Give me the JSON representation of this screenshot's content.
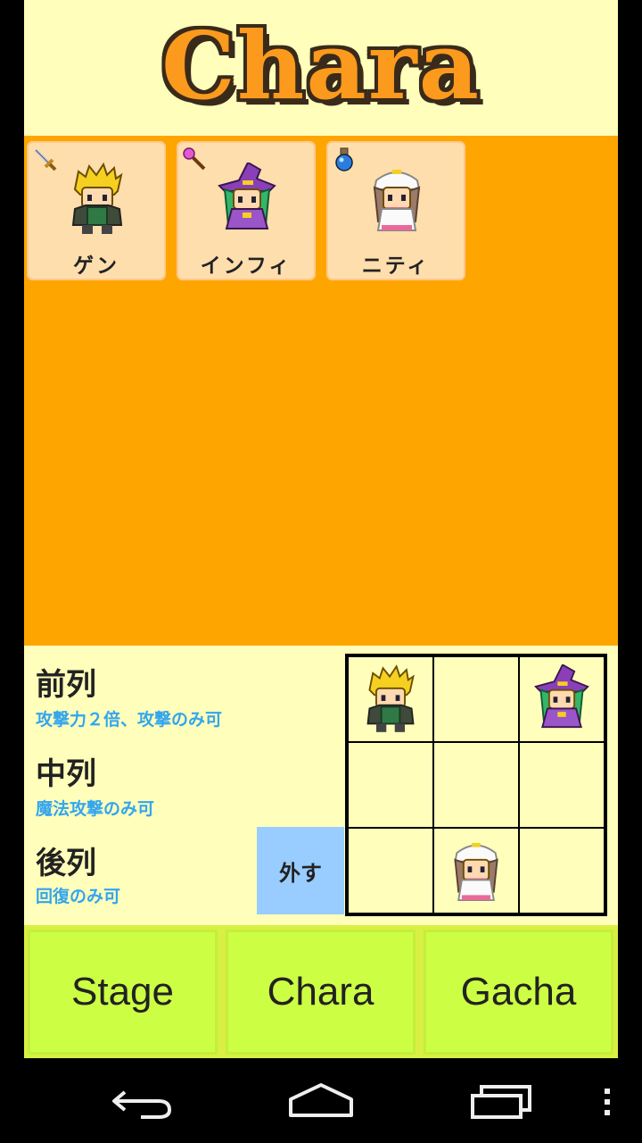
{
  "header": {
    "title": "Chara"
  },
  "characters": [
    {
      "name": "ゲン",
      "weapon_icon": "sword-icon",
      "sprite": "swordsman-sprite"
    },
    {
      "name": "インフィ",
      "weapon_icon": "wand-icon",
      "sprite": "witch-sprite"
    },
    {
      "name": "ニティ",
      "weapon_icon": "potion-icon",
      "sprite": "healer-sprite"
    }
  ],
  "formation": {
    "rows": [
      {
        "label": "前列",
        "desc": "攻撃力２倍、攻撃のみ可"
      },
      {
        "label": "中列",
        "desc": "魔法攻撃のみ可"
      },
      {
        "label": "後列",
        "desc": "回復のみ可"
      }
    ],
    "remove_label": "外す",
    "grid": [
      [
        "swordsman",
        "",
        "witch"
      ],
      [
        "",
        "",
        ""
      ],
      [
        "",
        "healer",
        ""
      ]
    ]
  },
  "nav": {
    "items": [
      "Stage",
      "Chara",
      "Gacha"
    ]
  },
  "colors": {
    "background": "#ffffbb",
    "character_area": "#ffa500",
    "card": "#ffdead",
    "nav": "#ccff44",
    "remove_button": "#99ccff",
    "desc_text": "#33a5ee",
    "title": "#fb9a1d"
  },
  "system_nav": {
    "icons": [
      "back-icon",
      "home-icon",
      "recents-icon",
      "menu-icon"
    ]
  }
}
